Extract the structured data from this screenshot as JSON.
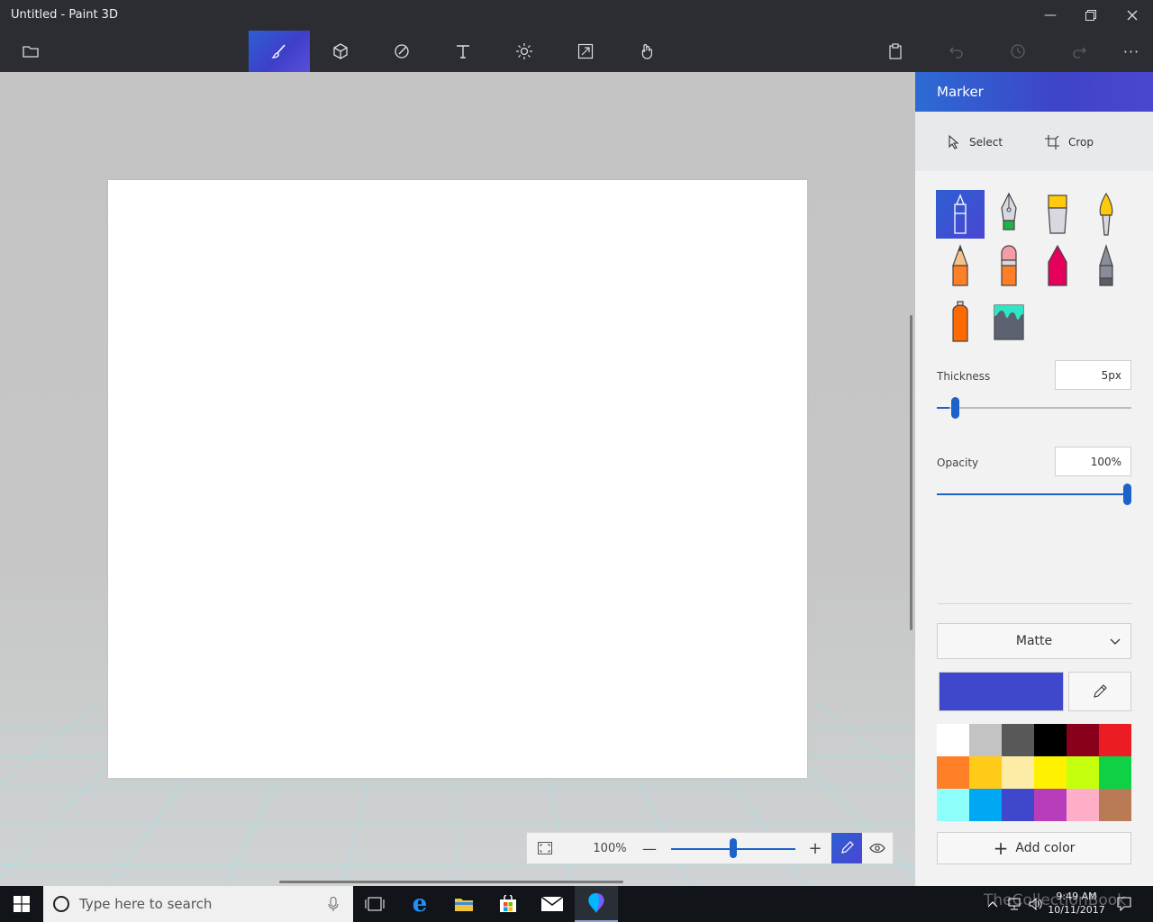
{
  "window": {
    "title": "Untitled - Paint 3D"
  },
  "panel": {
    "title": "Marker",
    "select_label": "Select",
    "crop_label": "Crop",
    "thickness_label": "Thickness",
    "thickness_value": "5px",
    "thickness_level": 0.05,
    "opacity_label": "Opacity",
    "opacity_value": "100%",
    "opacity_level": 1.0,
    "finish_label": "Matte",
    "current_color": "#3f48cc",
    "add_color_label": "Add color",
    "palette": [
      "#ffffff",
      "#c3c3c3",
      "#585858",
      "#000000",
      "#88001b",
      "#ec1c24",
      "#ff7f27",
      "#ffca18",
      "#fdeca6",
      "#fff200",
      "#c4ff0e",
      "#0ed145",
      "#8cfffb",
      "#00a8f3",
      "#3f48cc",
      "#b83dba",
      "#ffaec8",
      "#b97a56"
    ]
  },
  "zoom": {
    "value": "100%",
    "level": 0.5
  },
  "taskbar": {
    "search_placeholder": "Type here to search",
    "time": "9:49 AM",
    "date": "10/11/2017",
    "watermark": "TheCollectionBook"
  }
}
